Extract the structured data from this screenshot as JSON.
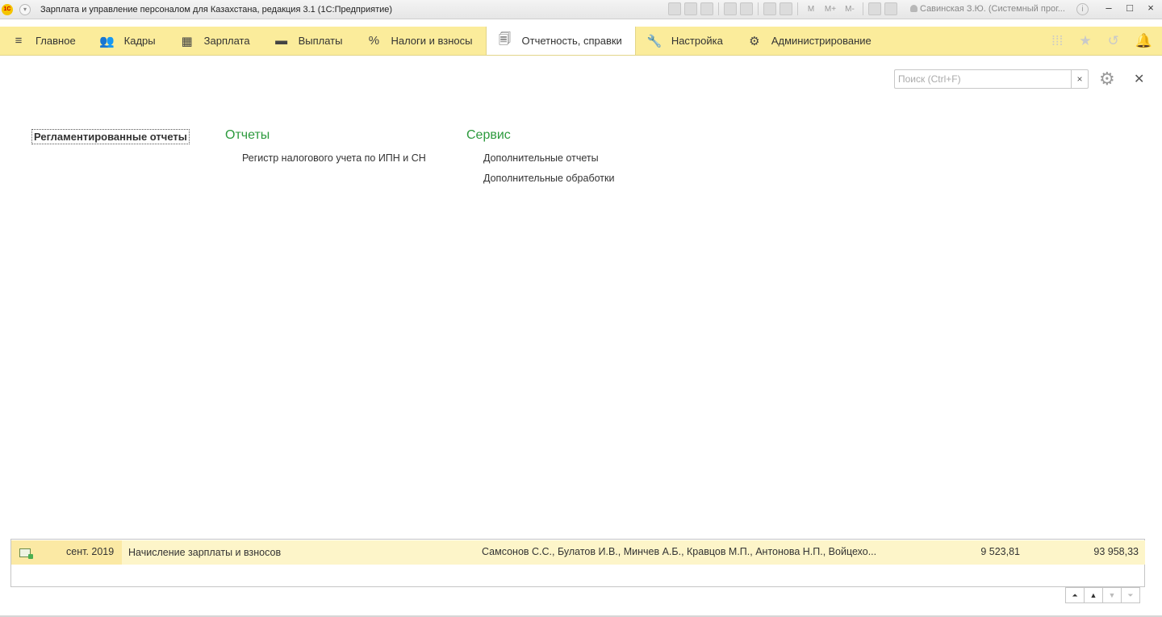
{
  "app": {
    "logo_text": "1С",
    "title": "Зарплата и управление персоналом для Казахстана, редакция 3.1  (1С:Предприятие)",
    "user": "Савинская З.Ю. (Системный прог...",
    "toolbar_m": [
      "M",
      "M+",
      "M-"
    ],
    "window_controls": [
      "‒",
      "□",
      "×"
    ]
  },
  "sections": [
    {
      "label": "Главное",
      "icon": "menu-icon",
      "glyph": "≡"
    },
    {
      "label": "Кадры",
      "icon": "people-icon",
      "glyph": "👥"
    },
    {
      "label": "Зарплата",
      "icon": "calculator-icon",
      "glyph": "▦"
    },
    {
      "label": "Выплаты",
      "icon": "wallet-icon",
      "glyph": "▬"
    },
    {
      "label": "Налоги и взносы",
      "icon": "percent-icon",
      "glyph": "%"
    },
    {
      "label": "Отчетность, справки",
      "icon": "document-icon",
      "glyph": "🗐",
      "active": true
    },
    {
      "label": "Настройка",
      "icon": "wrench-icon",
      "glyph": "🔧"
    },
    {
      "label": "Администрирование",
      "icon": "gear-icon",
      "glyph": "⚙"
    }
  ],
  "search": {
    "placeholder": "Поиск (Ctrl+F)",
    "value": "",
    "clear": "×"
  },
  "panel": {
    "left_item": "Регламентированные отчеты",
    "groups": [
      {
        "title": "Отчеты",
        "links": [
          "Регистр налогового учета по ИПН и СН"
        ]
      },
      {
        "title": "Сервис",
        "links": [
          "Дополнительные отчеты",
          "Дополнительные обработки"
        ]
      }
    ]
  },
  "history_row": {
    "date": "сент. 2019",
    "document": "Начисление зарплаты и взносов",
    "employees": "Самсонов С.С., Булатов И.В., Минчев А.Б., Кравцов М.П., Антонова Н.П., Войцехо...",
    "sum1": "9 523,81",
    "sum2": "93 958,33"
  },
  "colors": {
    "sections_bg": "#fbec9b",
    "group_title": "#2c9a3d",
    "row_bg": "#fdf5c9"
  }
}
